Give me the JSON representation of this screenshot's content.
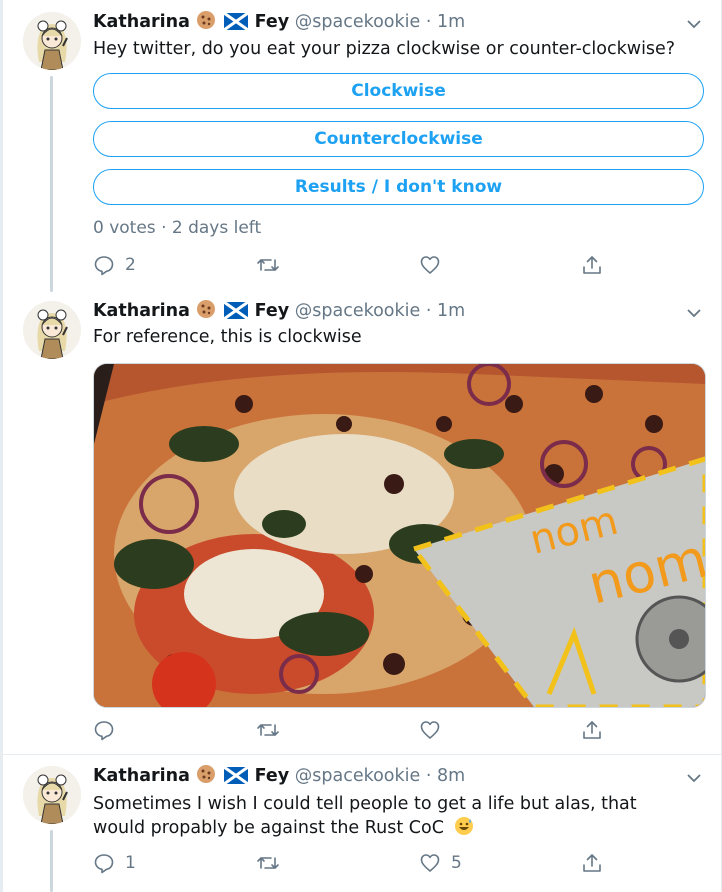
{
  "tweets": [
    {
      "name": "Katharina",
      "surname": "Fey",
      "handle": "@spacekookie",
      "time": "· 1m",
      "text": "Hey twitter, do you eat your pizza clockwise or counter-clockwise?",
      "poll": {
        "options": [
          "Clockwise",
          "Counterclockwise",
          "Results / I don't know"
        ],
        "meta": "0 votes · 2 days left"
      },
      "replies": "2",
      "retweets": "",
      "likes": ""
    },
    {
      "name": "Katharina",
      "surname": "Fey",
      "handle": "@spacekookie",
      "time": "· 1m",
      "text": "For reference, this is clockwise",
      "image": {
        "overlay_text_1": "nom",
        "overlay_text_2": "nom"
      },
      "replies": "",
      "retweets": "",
      "likes": ""
    },
    {
      "name": "Katharina",
      "surname": "Fey",
      "handle": "@spacekookie",
      "time": "· 8m",
      "text": "Sometimes I wish I could tell people to get a life but alas, that would propably be against the Rust CoC",
      "replies": "1",
      "retweets": "",
      "likes": "5"
    }
  ],
  "colors": {
    "accent": "#1da1f2",
    "secondary_text": "#657786",
    "thread_line": "#ccd6dd"
  },
  "icons": [
    "reply-icon",
    "retweet-icon",
    "like-icon",
    "share-icon",
    "chevron-down-icon",
    "cookie-emoji",
    "scotland-flag-emoji",
    "grinning-sweat-emoji"
  ]
}
